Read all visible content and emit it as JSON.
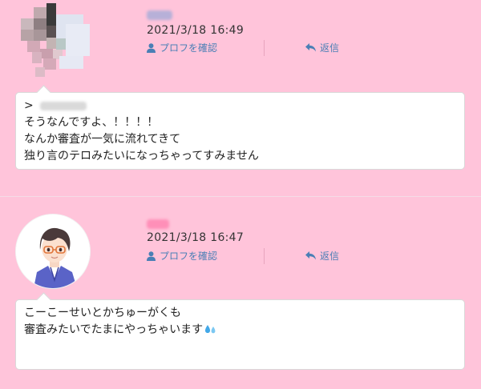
{
  "posts": [
    {
      "timestamp": "2021/3/18 16:49",
      "profile_label": "プロフを確認",
      "reply_label": "返信",
      "message": {
        "quote_prefix": ">",
        "lines": [
          "そうなんですよ、！！！！",
          "なんか審査が一気に流れてきて",
          "独り言のテロみたいになっちゃってすみません"
        ]
      }
    },
    {
      "timestamp": "2021/3/18 16:47",
      "profile_label": "プロフを確認",
      "reply_label": "返信",
      "message": {
        "lines": [
          "こーこーせいとかちゅーがくも",
          "審査みたいでたまにやっちゃいます"
        ]
      }
    }
  ],
  "colors": {
    "background": "#ffc4da",
    "link": "#4a7fb5",
    "text": "#222222"
  },
  "icons": {
    "profile": "person-icon",
    "reply": "reply-arrow-icon",
    "emoji": "sweat-droplets-emoji"
  }
}
